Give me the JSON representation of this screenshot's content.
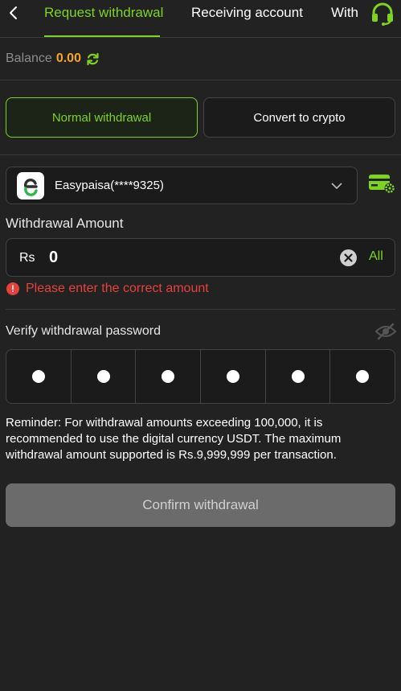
{
  "header": {
    "tabs": [
      {
        "label": "Request withdrawal",
        "active": true
      },
      {
        "label": "Receiving account",
        "active": false
      },
      {
        "label": "With",
        "active": false
      }
    ],
    "back_icon": "chevron-left-icon",
    "support_icon": "headset-icon"
  },
  "balance": {
    "label": "Balance",
    "value": "0.00",
    "icon": "refresh-icon"
  },
  "modes": {
    "normal": "Normal withdrawal",
    "crypto": "Convert to crypto",
    "selected": "normal"
  },
  "account": {
    "name": "Easypaisa(****9325)",
    "logo_letter": "e",
    "icon": "card-settings-icon"
  },
  "amount": {
    "label": "Withdrawal Amount",
    "currency": "Rs",
    "value": "0",
    "all_label": "All",
    "error": "Please enter the correct amount"
  },
  "password": {
    "label": "Verify withdrawal password",
    "digits": 6,
    "icon": "eye-off-icon"
  },
  "reminder": "Reminder: For withdrawal amounts exceeding 100,000, it is recommended to use the digital currency USDT. The maximum withdrawal amount supported is Rs.9,999,999 per transaction.",
  "confirm_label": "Confirm withdrawal",
  "colors": {
    "accent": "#7ed321",
    "balance": "#f5a623",
    "error": "#e8413a",
    "background": "#222222"
  }
}
